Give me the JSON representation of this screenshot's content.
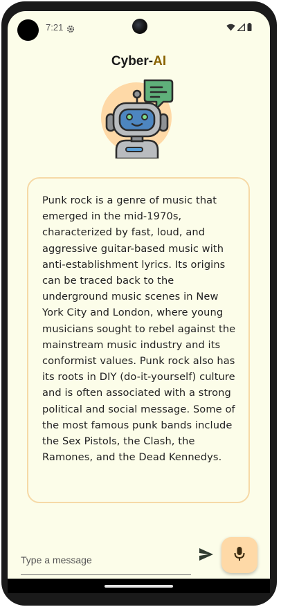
{
  "status_bar": {
    "time": "7:21",
    "icons": [
      "gear-icon",
      "wifi-icon",
      "signal-icon",
      "battery-icon"
    ]
  },
  "header": {
    "title_prefix": "Cyber-",
    "title_accent": "AI",
    "accent_color": "#8a6300",
    "avatar_icon": "robot-chat-icon"
  },
  "conversation": {
    "messages": [
      {
        "role": "assistant",
        "text": "Punk rock is a genre of music that emerged in the mid-1970s, characterized by fast, loud, and aggressive guitar-based music with anti-establishment lyrics. Its origins can be traced back to the underground music scenes in New York City and London, where young musicians sought to rebel against the mainstream music industry and its conformist values. Punk rock also has its roots in DIY (do-it-yourself) culture and is often associated with a strong political and social message. Some of the most famous punk bands include the Sex Pistols, the Clash, the Ramones, and the Dead Kennedys."
      }
    ]
  },
  "composer": {
    "placeholder": "Type a message",
    "value": "",
    "send_icon": "send-icon",
    "mic_icon": "mic-icon"
  },
  "theme": {
    "background": "#fcfde9",
    "card_border": "#f6d9a6",
    "mic_button": "#fed9a7"
  }
}
